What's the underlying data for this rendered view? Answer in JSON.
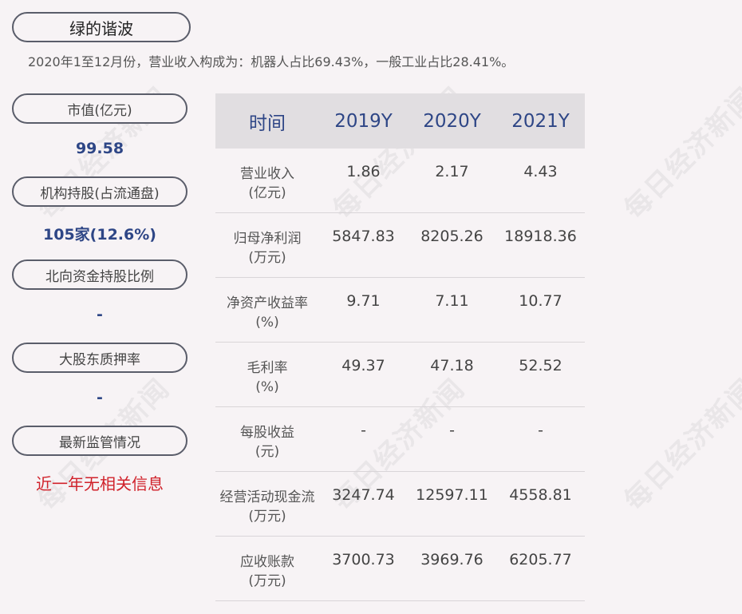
{
  "title": "绿的谐波",
  "summary": "2020年1至12月份，营业收入构成为：机器人占比69.43%，一般工业占比28.41%。",
  "sidebar": [
    {
      "label": "市值(亿元)",
      "value": "99.58"
    },
    {
      "label": "机构持股(占流通盘)",
      "value": "105家(12.6%)"
    },
    {
      "label": "北向资金持股比例",
      "value": "-"
    },
    {
      "label": "大股东质押率",
      "value": "-"
    },
    {
      "label": "最新监管情况",
      "value": "近一年无相关信息"
    }
  ],
  "table": {
    "headers": [
      "时间",
      "2019Y",
      "2020Y",
      "2021Y"
    ],
    "rows": [
      {
        "name": "营业收入",
        "unit": "(亿元)",
        "values": [
          "1.86",
          "2.17",
          "4.43"
        ]
      },
      {
        "name": "归母净利润",
        "unit": "(万元)",
        "values": [
          "5847.83",
          "8205.26",
          "18918.36"
        ]
      },
      {
        "name": "净资产收益率",
        "unit": "(%)",
        "values": [
          "9.71",
          "7.11",
          "10.77"
        ]
      },
      {
        "name": "毛利率",
        "unit": "(%)",
        "values": [
          "49.37",
          "47.18",
          "52.52"
        ]
      },
      {
        "name": "每股收益",
        "unit": "(元)",
        "values": [
          "-",
          "-",
          "-"
        ]
      },
      {
        "name": "经营活动现金流",
        "unit": "(万元)",
        "values": [
          "3247.74",
          "12597.11",
          "4558.81"
        ]
      },
      {
        "name": "应收账款",
        "unit": "(万元)",
        "values": [
          "3700.73",
          "3969.76",
          "6205.77"
        ]
      }
    ]
  },
  "watermark": "每日经济新闻",
  "colors": {
    "accent": "#2e4686",
    "alert": "#d0212a",
    "header_bg": "#e1dee1"
  }
}
